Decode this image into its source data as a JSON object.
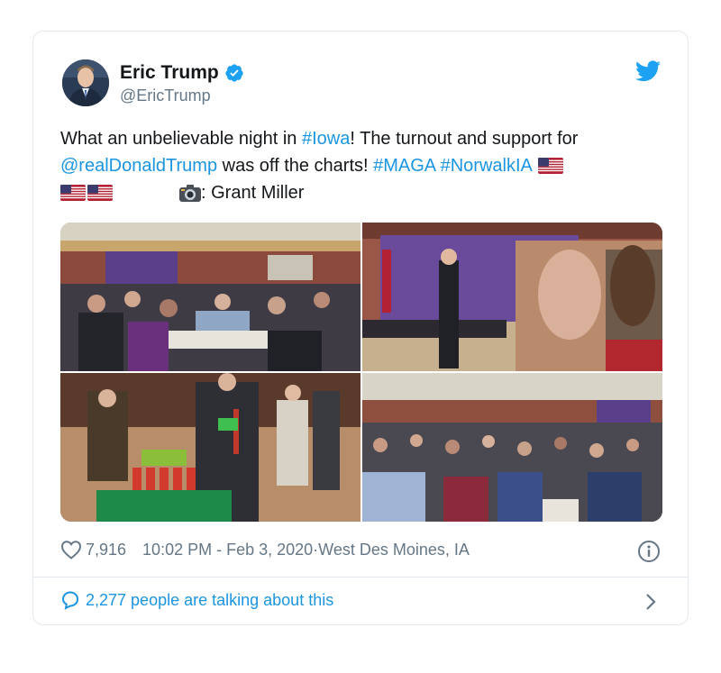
{
  "tweet": {
    "author": {
      "name": "Eric Trump",
      "handle": "@EricTrump"
    },
    "text": {
      "part1": "What an unbelievable night in ",
      "hashtag_iowa": "#Iowa",
      "part2": "! The turnout and support for",
      "mention": "@realDonaldTrump",
      "part3": " was off the charts! ",
      "hashtag_maga": "#MAGA",
      "space": " ",
      "hashtag_norwalk": "#NorwalkIA",
      "photo_credit": ": Grant Miller"
    },
    "photo_count": 4,
    "likes": "7,916",
    "timestamp": "10:02 PM - Feb 3, 2020",
    "separator": " · ",
    "location": "West Des Moines, IA",
    "talking": "2,277 people are talking about this"
  },
  "colors": {
    "link": "#1b95e0",
    "secondary_text": "#657786",
    "border": "#e1e8ed",
    "verified": "#1da1f2"
  },
  "icons": [
    "verified-icon",
    "twitter-bird-icon",
    "flag-us-icon",
    "camera-icon",
    "heart-icon",
    "info-icon",
    "comment-bubble-icon",
    "chevron-right-icon"
  ]
}
